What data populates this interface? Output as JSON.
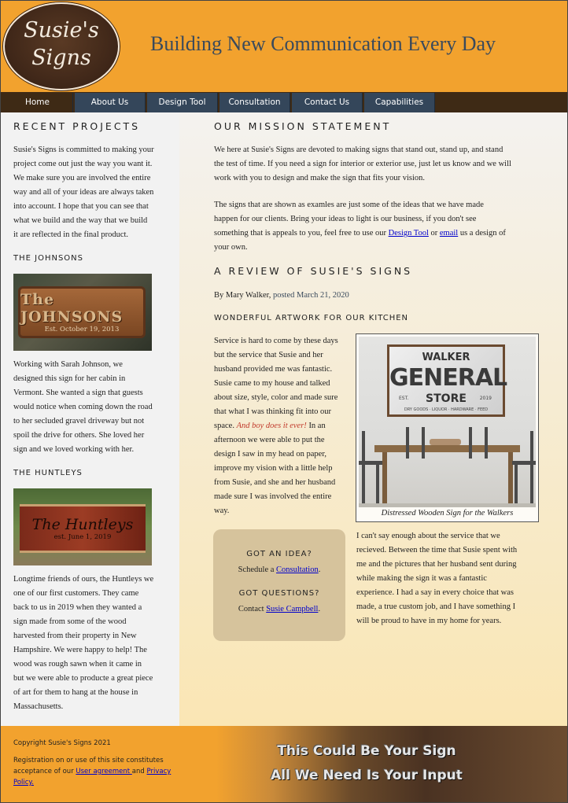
{
  "header": {
    "logo_line1": "Susie's",
    "logo_line2": "Signs",
    "title": "Building New Communication Every Day"
  },
  "nav": {
    "items": [
      {
        "label": "Home"
      },
      {
        "label": "About Us"
      },
      {
        "label": "Design Tool"
      },
      {
        "label": "Consultation"
      },
      {
        "label": "Contact Us"
      },
      {
        "label": "Capabilities"
      }
    ]
  },
  "sidebar": {
    "heading": "RECENT PROJECTS",
    "intro_lines": [
      "Susie's Signs is committed to making your",
      "project come out just the way you want it.",
      "We make sure you are involved the entire",
      "way and all of your ideas are always taken",
      "into account. I hope that you can see that",
      "what we build and the way that we build",
      "it are reflected in the final product."
    ],
    "johnsons": {
      "heading": "THE JOHNSONS",
      "sign_name": "The JOHNSONS",
      "sign_date": "Est. October 19, 2013",
      "lines": [
        "Working with Sarah Johnson, we",
        "designed this sign for her cabin in",
        "Vermont. She wanted a sign that guests",
        "would notice when coming down the road",
        "to her secluded gravel driveway but not",
        "spoil the drive for others. She loved her",
        "sign and we loved working with her."
      ]
    },
    "huntleys": {
      "heading": "THE HUNTLEYS",
      "sign_name": "The Huntleys",
      "sign_date": "est. June 1, 2019",
      "lines": [
        "Longtime friends of ours, the Huntleys we",
        "one of our first customers. They came",
        "back to us in 2019 when they wanted a",
        "sign made from some of the wood",
        "harvested from their property in New",
        "Hampshire. We were happy to help! The",
        "wood was rough sawn when it came in",
        "but we were able to producte a great piece",
        "of art for them to hang at the house in",
        "Massachusetts."
      ]
    }
  },
  "mission": {
    "heading": "OUR MISSION STATEMENT",
    "p1_lines": [
      "We here at Susie's Signs are devoted to making signs that stand out, stand up, and stand",
      "the test of time. If you need a sign for interior or exterior use, just let us know and we will",
      "work with you to design and make the sign that fits your vision."
    ],
    "p2_line1": "The signs that are shown as examles are just some of the ideas that we have made",
    "p2_line2": "happen for our clients. Bring your ideas to light is our business, if you don't see",
    "p2_line3_pre": "something that is appeals to you, feel free to use our ",
    "p2_link1": "Design Tool",
    "p2_line3_mid": " or ",
    "p2_link2": "email",
    "p2_line3_post": " us a design of",
    "p2_line4": "your own."
  },
  "review": {
    "heading": "A REVIEW OF SUSIE'S SIGNS",
    "byline": "By Mary Walker,",
    "posted": "posted March 21, 2020",
    "subheading": "WONDERFUL ARTWORK FOR OUR KITCHEN",
    "left_lines": [
      "Service is hard to come by these days",
      "but the service that Susie and her",
      "husband provided me was fantastic.",
      "Susie came to my house and talked",
      "about size, style, color and made sure",
      "that what I was thinking fit into our"
    ],
    "space_text": "space. ",
    "emphasis": "And boy does it ever!",
    "after_emphasis": " In an",
    "left_lines2": [
      "afternoon we were able to put the",
      "design I saw in my head on paper,",
      "improve my vision with a little help",
      "from Susie, and she and her husband",
      "made sure I was involved the entire",
      "way."
    ],
    "figure_sign": {
      "line1": "WALKER",
      "line2": "GENERAL",
      "line3": "STORE",
      "est": "EST.",
      "year": "2019",
      "tagline": "DRY GOODS · LIQUOR · HARDWARE · FEED"
    },
    "caption": "Distressed Wooden Sign for the Walkers",
    "right_lines": [
      "I can't say enough about the service that we",
      "recieved. Between the time that Susie spent with",
      "me and the pictures that her husband sent during",
      "while making the sign it was a fantastic",
      "experience. I had a say in every choice that was",
      "made, a true custom job, and I have something I",
      "will be proud to have in my home for years."
    ]
  },
  "idea_box": {
    "heading1": "GOT AN IDEA?",
    "line1_pre": "Schedule a ",
    "line1_link": "Consultation",
    "line1_post": ".",
    "heading2": "GOT QUESTIONS?",
    "line2_pre": "Contact ",
    "line2_link": "Susie Campbell",
    "line2_post": "."
  },
  "footer": {
    "copyright": "Copyright Susie's Signs 2021",
    "reg_line1": "Registration on or use of this site constitutes",
    "reg_line2_pre": "acceptance of our ",
    "user_agreement": "User agreement ",
    "and_text": "and ",
    "privacy1": "Privacy",
    "privacy2": "Policy.",
    "slogan1": "This Could Be Your Sign",
    "slogan2": "All We Need Is Your Input"
  },
  "colors": {
    "header_orange": "#f2a22e",
    "nav_bg": "#34465a",
    "title_color": "#3a4a5c",
    "emphasis_red": "#c0392b",
    "idea_box": "#d6c39c"
  }
}
